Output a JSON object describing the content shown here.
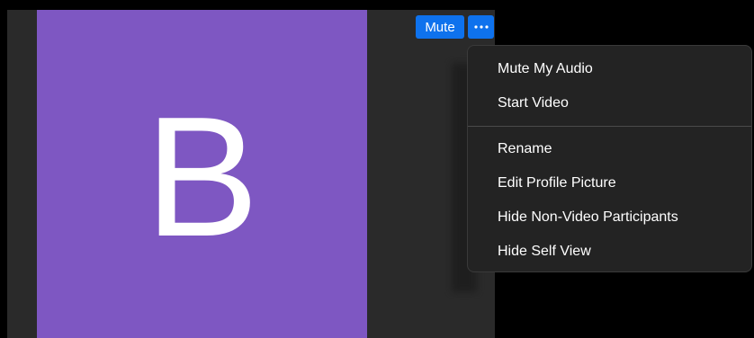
{
  "tile": {
    "avatar_letter": "B",
    "avatar_color": "#7e57c2"
  },
  "controls": {
    "mute_label": "Mute",
    "more_icon": "ellipsis-icon",
    "accent_color": "#0e72ed"
  },
  "menu": {
    "group1": [
      {
        "label": "Mute My Audio"
      },
      {
        "label": "Start Video"
      }
    ],
    "group2": [
      {
        "label": "Rename"
      },
      {
        "label": "Edit Profile Picture"
      },
      {
        "label": "Hide Non-Video Participants"
      },
      {
        "label": "Hide Self View"
      }
    ]
  }
}
